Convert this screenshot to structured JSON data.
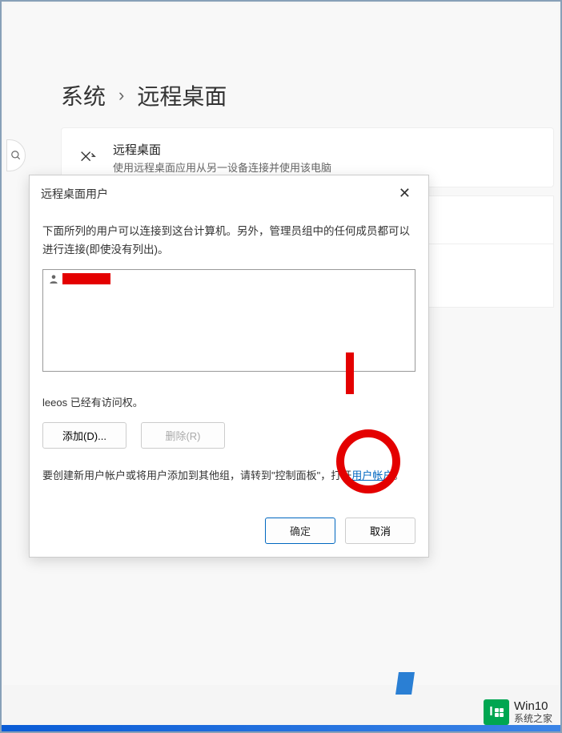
{
  "breadcrumb": {
    "system": "系统",
    "chevron": "›",
    "current": "远程桌面"
  },
  "card": {
    "title": "远程桌面",
    "desc": "使用远程桌面应用从另一设备连接并使用该电脑"
  },
  "dialog": {
    "title": "远程桌面用户",
    "close_glyph": "✕",
    "msg": "下面所列的用户可以连接到这台计算机。另外，管理员组中的任何成员都可以进行连接(即使没有列出)。",
    "access_note": "leeos 已经有访问权。",
    "add_btn": "添加(D)...",
    "remove_btn": "删除(R)",
    "hint_prefix": "要创建新用户帐户或将用户添加到其他组，请转到\"控制面板\"，打开",
    "hint_link": "用户帐户",
    "hint_suffix": "。",
    "ok_btn": "确定",
    "cancel_btn": "取消"
  },
  "watermark": {
    "brand": "Win10",
    "sub": "系统之家"
  }
}
